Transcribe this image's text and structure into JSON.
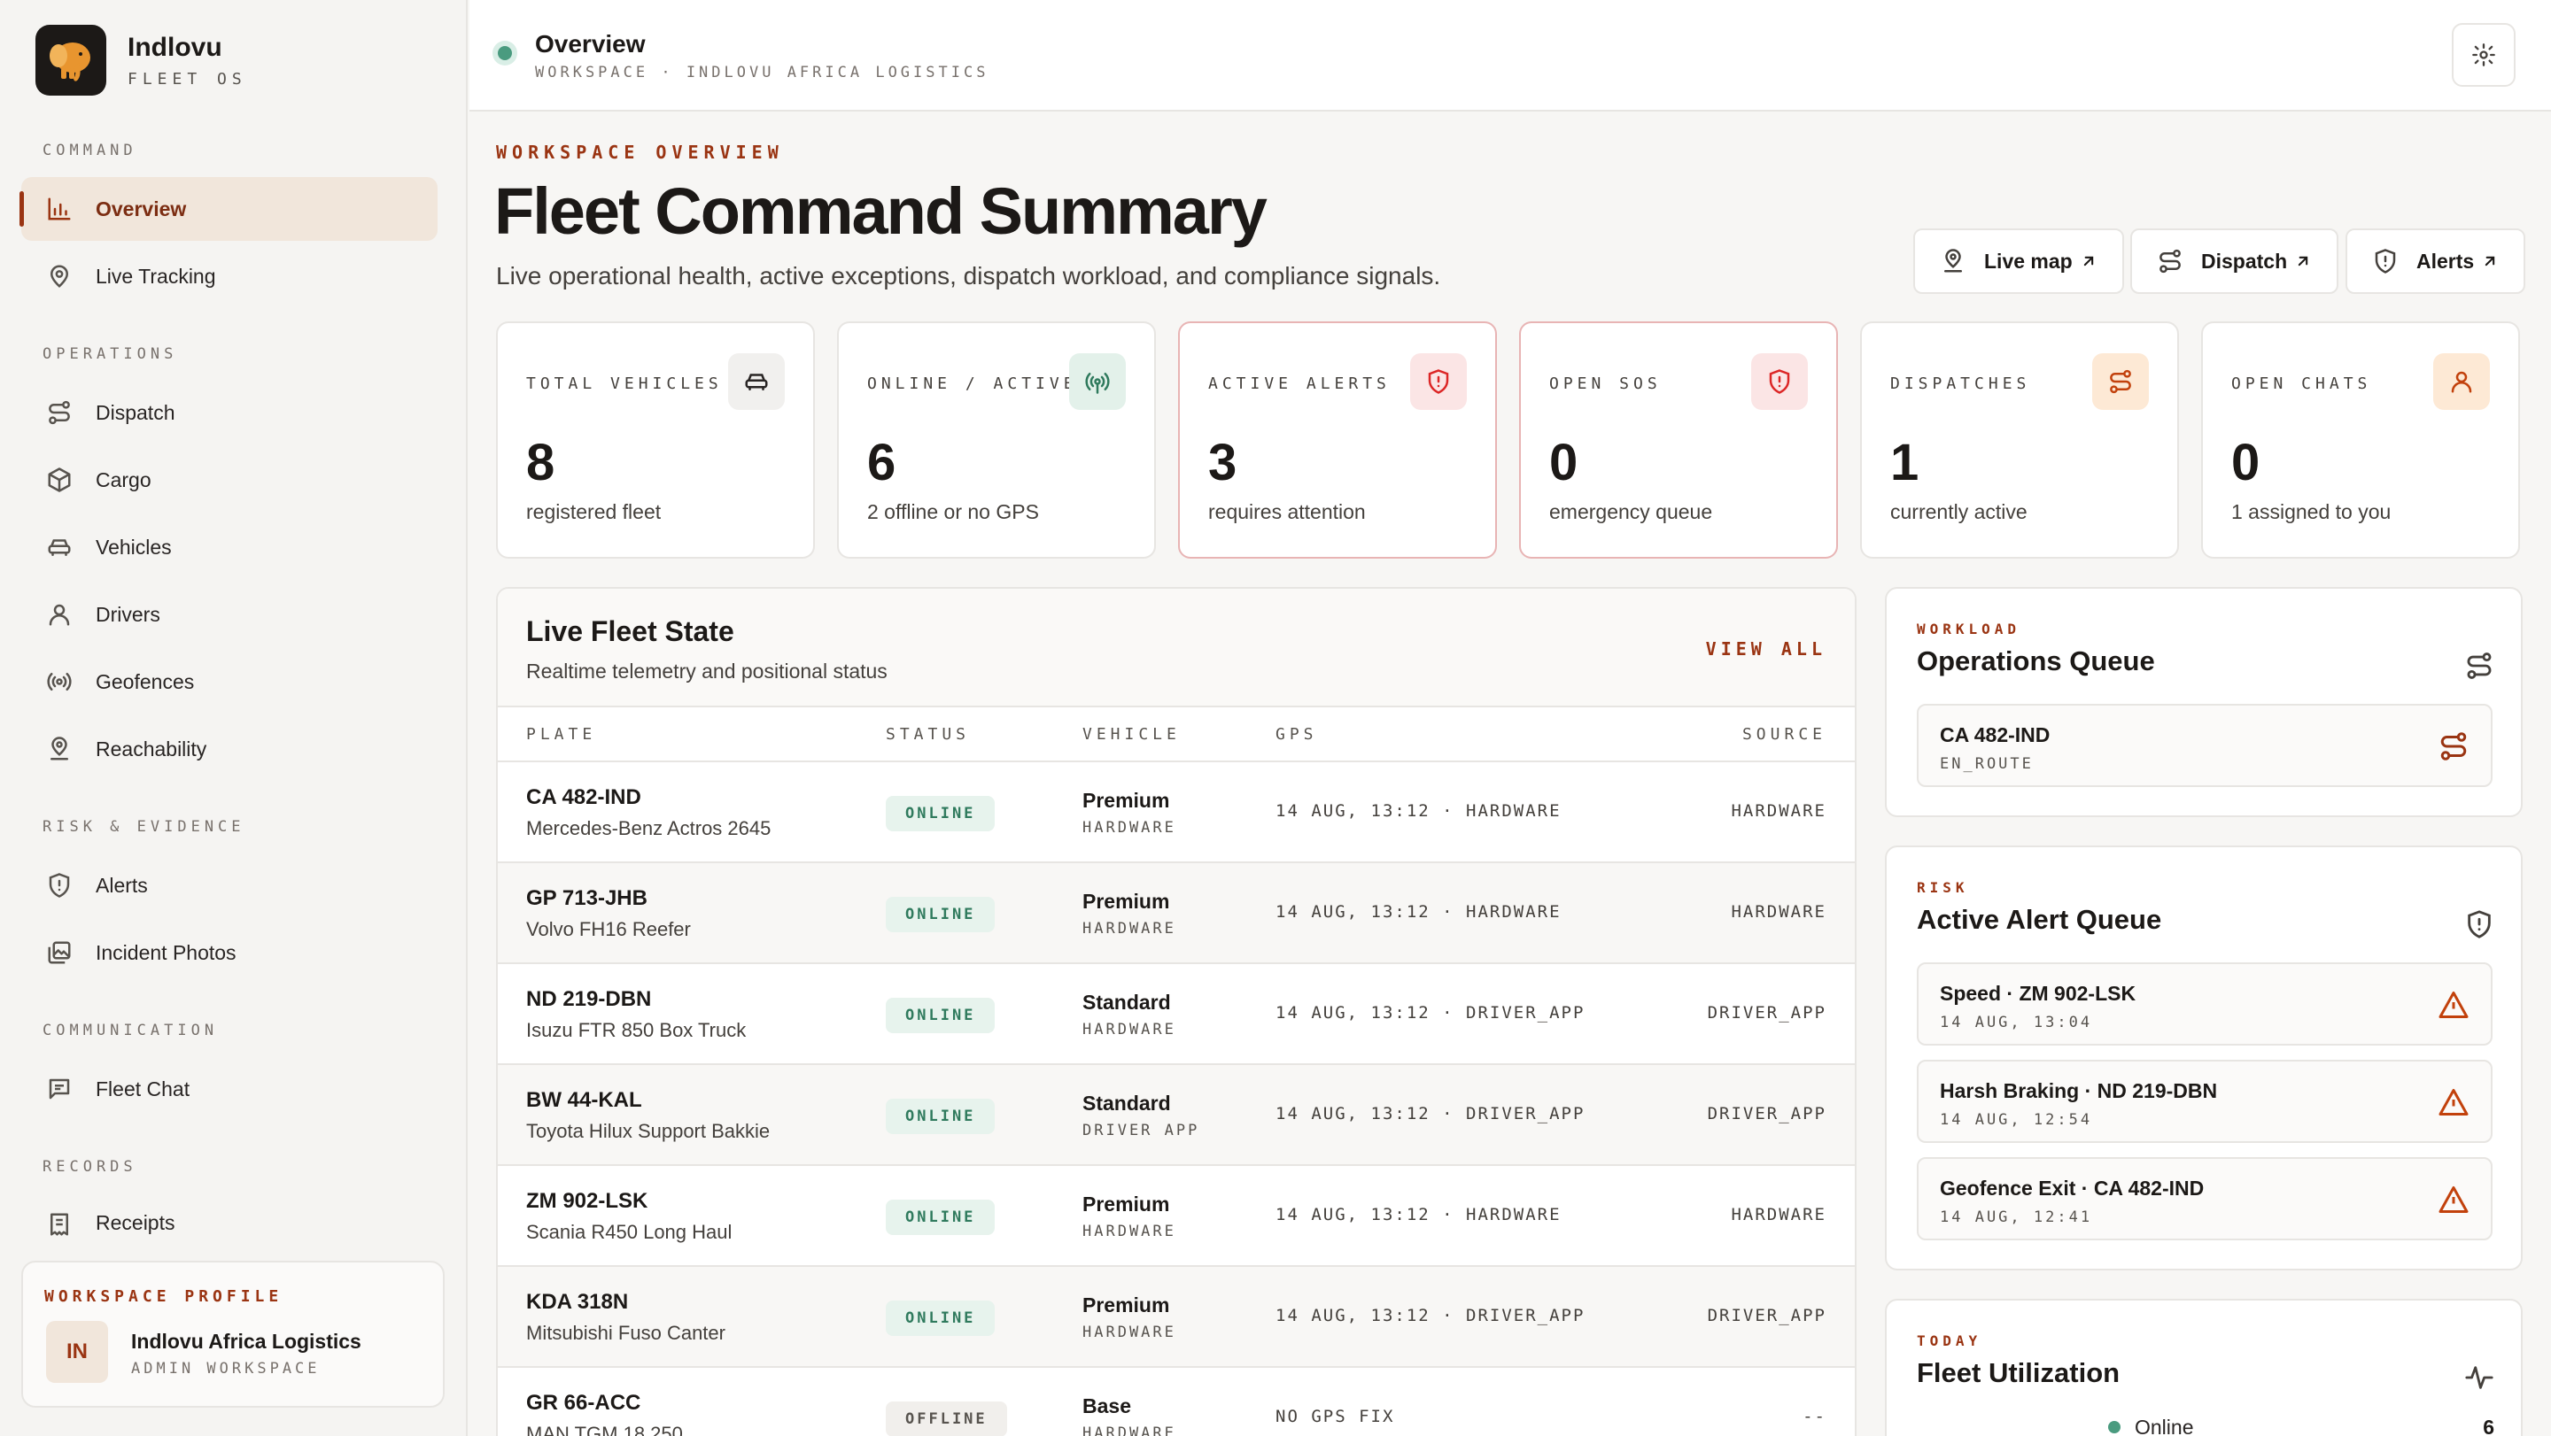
{
  "brand": {
    "name": "Indlovu",
    "subtitle": "FLEET OS"
  },
  "sidebar": {
    "sections": [
      {
        "label": "COMMAND"
      },
      {
        "label": "OPERATIONS"
      },
      {
        "label": "RISK & EVIDENCE"
      },
      {
        "label": "COMMUNICATION"
      },
      {
        "label": "RECORDS"
      }
    ],
    "items": [
      {
        "label": "Overview",
        "icon": "bar-chart-icon",
        "active": true
      },
      {
        "label": "Live Tracking",
        "icon": "map-pin-icon"
      },
      {
        "label": "Dispatch",
        "icon": "route-icon"
      },
      {
        "label": "Cargo",
        "icon": "package-icon"
      },
      {
        "label": "Vehicles",
        "icon": "car-icon"
      },
      {
        "label": "Drivers",
        "icon": "user-icon"
      },
      {
        "label": "Geofences",
        "icon": "radio-icon"
      },
      {
        "label": "Reachability",
        "icon": "map-pin-user-icon"
      },
      {
        "label": "Alerts",
        "icon": "shield-alert-icon"
      },
      {
        "label": "Incident Photos",
        "icon": "images-icon"
      },
      {
        "label": "Fleet Chat",
        "icon": "message-square-icon"
      },
      {
        "label": "Receipts",
        "icon": "receipt-icon"
      }
    ],
    "profile": {
      "label": "WORKSPACE PROFILE",
      "initials": "IN",
      "name": "Indlovu Africa Logistics",
      "role": "ADMIN WORKSPACE"
    }
  },
  "topbar": {
    "title": "Overview",
    "subtitle": "WORKSPACE · INDLOVU AFRICA LOGISTICS",
    "settings_icon": "gear-icon"
  },
  "header": {
    "eyebrow": "WORKSPACE OVERVIEW",
    "title": "Fleet Command Summary",
    "description": "Live operational health, active exceptions, dispatch workload, and compliance signals.",
    "actions": [
      {
        "label": "Live map",
        "icon": "map-pin-icon"
      },
      {
        "label": "Dispatch",
        "icon": "route-icon"
      },
      {
        "label": "Alerts",
        "icon": "shield-alert-icon"
      }
    ]
  },
  "kpis": [
    {
      "label": "TOTAL VEHICLES",
      "value": "8",
      "note": "registered fleet",
      "icon": "car-icon",
      "tone": "neutral"
    },
    {
      "label": "ONLINE / ACTIVE",
      "value": "6",
      "note": "2 offline or no GPS",
      "icon": "radio-icon",
      "tone": "green"
    },
    {
      "label": "ACTIVE ALERTS",
      "value": "3",
      "note": "requires attention",
      "icon": "shield-alert-icon",
      "tone": "red"
    },
    {
      "label": "OPEN SOS",
      "value": "0",
      "note": "emergency queue",
      "icon": "shield-alert-icon",
      "tone": "red"
    },
    {
      "label": "DISPATCHES",
      "value": "1",
      "note": "currently active",
      "icon": "route-icon",
      "tone": "orange"
    },
    {
      "label": "OPEN CHATS",
      "value": "0",
      "note": "1 assigned to you",
      "icon": "user-icon",
      "tone": "orange"
    }
  ],
  "fleet": {
    "title": "Live Fleet State",
    "subtitle": "Realtime telemetry and positional status",
    "view_all": "VIEW ALL",
    "columns": [
      "PLATE",
      "STATUS",
      "VEHICLE",
      "GPS",
      "SOURCE"
    ],
    "rows": [
      {
        "plate": "CA 482-IND",
        "model": "Mercedes-Benz Actros 2645",
        "status": "ONLINE",
        "tier": "Premium",
        "tier_src": "HARDWARE",
        "gps": "14 AUG, 13:12 · HARDWARE",
        "source": "HARDWARE"
      },
      {
        "plate": "GP 713-JHB",
        "model": "Volvo FH16 Reefer",
        "status": "ONLINE",
        "tier": "Premium",
        "tier_src": "HARDWARE",
        "gps": "14 AUG, 13:12 · HARDWARE",
        "source": "HARDWARE"
      },
      {
        "plate": "ND 219-DBN",
        "model": "Isuzu FTR 850 Box Truck",
        "status": "ONLINE",
        "tier": "Standard",
        "tier_src": "HARDWARE",
        "gps": "14 AUG, 13:12 · DRIVER_APP",
        "source": "DRIVER_APP"
      },
      {
        "plate": "BW 44-KAL",
        "model": "Toyota Hilux Support Bakkie",
        "status": "ONLINE",
        "tier": "Standard",
        "tier_src": "DRIVER APP",
        "gps": "14 AUG, 13:12 · DRIVER_APP",
        "source": "DRIVER_APP"
      },
      {
        "plate": "ZM 902-LSK",
        "model": "Scania R450 Long Haul",
        "status": "ONLINE",
        "tier": "Premium",
        "tier_src": "HARDWARE",
        "gps": "14 AUG, 13:12 · HARDWARE",
        "source": "HARDWARE"
      },
      {
        "plate": "KDA 318N",
        "model": "Mitsubishi Fuso Canter",
        "status": "ONLINE",
        "tier": "Premium",
        "tier_src": "HARDWARE",
        "gps": "14 AUG, 13:12 · DRIVER_APP",
        "source": "DRIVER_APP"
      },
      {
        "plate": "GR 66-ACC",
        "model": "MAN TGM 18.250",
        "status": "OFFLINE",
        "tier": "Base",
        "tier_src": "HARDWARE",
        "gps": "NO GPS FIX",
        "source": "--"
      }
    ]
  },
  "ops_queue": {
    "eyebrow": "WORKLOAD",
    "title": "Operations Queue",
    "items": [
      {
        "title": "CA 482-IND",
        "sub": "EN_ROUTE"
      }
    ]
  },
  "alert_queue": {
    "eyebrow": "RISK",
    "title": "Active Alert Queue",
    "items": [
      {
        "title": "Speed · ZM 902-LSK",
        "sub": "14 AUG, 13:04"
      },
      {
        "title": "Harsh Braking · ND 219-DBN",
        "sub": "14 AUG, 12:54"
      },
      {
        "title": "Geofence Exit · CA 482-IND",
        "sub": "14 AUG, 12:41"
      }
    ]
  },
  "utilization": {
    "eyebrow": "TODAY",
    "title": "Fleet Utilization",
    "legend": [
      {
        "label": "Online",
        "value": "6"
      }
    ]
  },
  "colors": {
    "accent": "#9a3412",
    "online": "#4a9b7f",
    "alert": "#dc2626"
  }
}
